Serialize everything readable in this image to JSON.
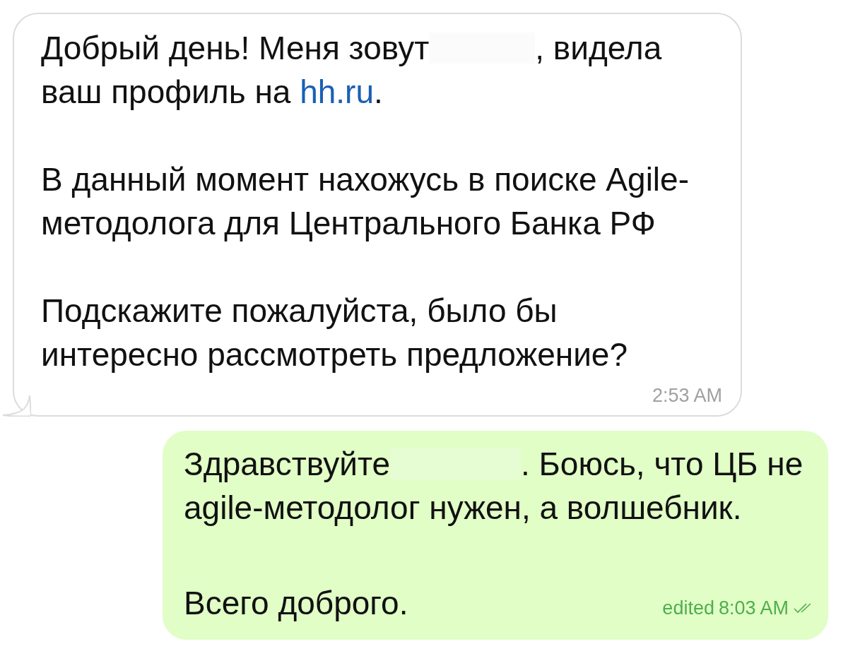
{
  "messages": [
    {
      "kind": "incoming",
      "paragraphs": [
        [
          [
            {
              "kind": "text",
              "text": "Добрый день! Меня зовут"
            },
            {
              "kind": "redacted"
            },
            {
              "kind": "text",
              "text": ", видела"
            }
          ],
          [
            {
              "kind": "text",
              "text": "ваш профиль на "
            },
            {
              "kind": "link",
              "text": "hh.ru"
            },
            {
              "kind": "text",
              "text": "."
            }
          ]
        ],
        [
          [
            {
              "kind": "text",
              "text": "В данный момент нахожусь в поиске Agile-"
            }
          ],
          [
            {
              "kind": "text",
              "text": "методолога для Центрального Банка РФ"
            }
          ]
        ],
        [
          [
            {
              "kind": "text",
              "text": "Подскажите пожалуйста, было бы"
            }
          ],
          [
            {
              "kind": "text",
              "text": "интересно рассмотреть предложение?"
            }
          ]
        ]
      ],
      "time": "2:53 AM"
    },
    {
      "kind": "outgoing",
      "paragraphs": [
        [
          [
            {
              "kind": "text",
              "text": "Здравствуйте"
            },
            {
              "kind": "redacted"
            },
            {
              "kind": "text",
              "text": ". Боюсь, что ЦБ не"
            }
          ],
          [
            {
              "kind": "text",
              "text": "agile-методолог нужен, а волшебник."
            }
          ]
        ],
        [
          [
            {
              "kind": "text",
              "text": "Всего доброго."
            }
          ]
        ]
      ],
      "edited": "edited",
      "time": "8:03 AM",
      "read": true
    }
  ]
}
